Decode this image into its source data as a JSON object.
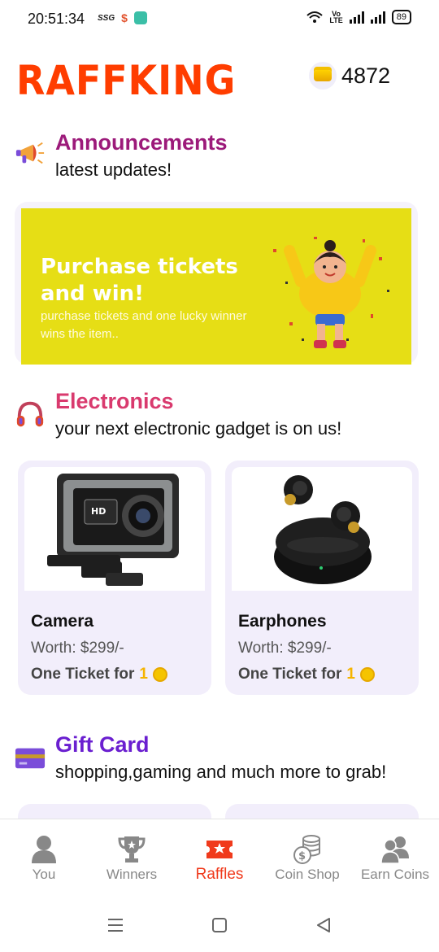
{
  "status_bar": {
    "time": "20:51:34",
    "mini_label": "SSG",
    "dollar_label": "$",
    "volte_top": "Vo",
    "volte_bottom": "LTE",
    "battery": "89"
  },
  "header": {
    "logo": "RAFFKING",
    "coins": "4872"
  },
  "announcements": {
    "title": "Announcements",
    "subtitle": "latest updates!",
    "title_color": "#9c1a7a",
    "banner": {
      "title": "Purchase tickets and win!",
      "subtitle": "purchase tickets and one lucky winner wins the item..",
      "bg_color": "#e6de15"
    }
  },
  "electronics": {
    "title": "Electronics",
    "subtitle": "your next electronic gadget is on us!",
    "title_color": "#d93a6e",
    "items": [
      {
        "name": "Camera",
        "worth": "Worth: $299/-",
        "ticket_label": "One Ticket for",
        "ticket_count": "1",
        "image_icon": "action-camera-icon"
      },
      {
        "name": "Earphones",
        "worth": "Worth: $299/-",
        "ticket_label": "One Ticket for",
        "ticket_count": "1",
        "image_icon": "earbuds-icon"
      }
    ]
  },
  "gift_card": {
    "title": "Gift Card",
    "subtitle": "shopping,gaming and much more to grab!",
    "title_color": "#6a1fd0"
  },
  "bottom_nav": {
    "items": [
      {
        "label": "You",
        "icon": "user-icon",
        "active": false
      },
      {
        "label": "Winners",
        "icon": "trophy-icon",
        "active": false
      },
      {
        "label": "Raffles",
        "icon": "ticket-star-icon",
        "active": true
      },
      {
        "label": "Coin Shop",
        "icon": "coin-stack-icon",
        "active": false
      },
      {
        "label": "Earn Coins",
        "icon": "users-icon",
        "active": false
      }
    ],
    "active_color": "#f03a1c"
  }
}
